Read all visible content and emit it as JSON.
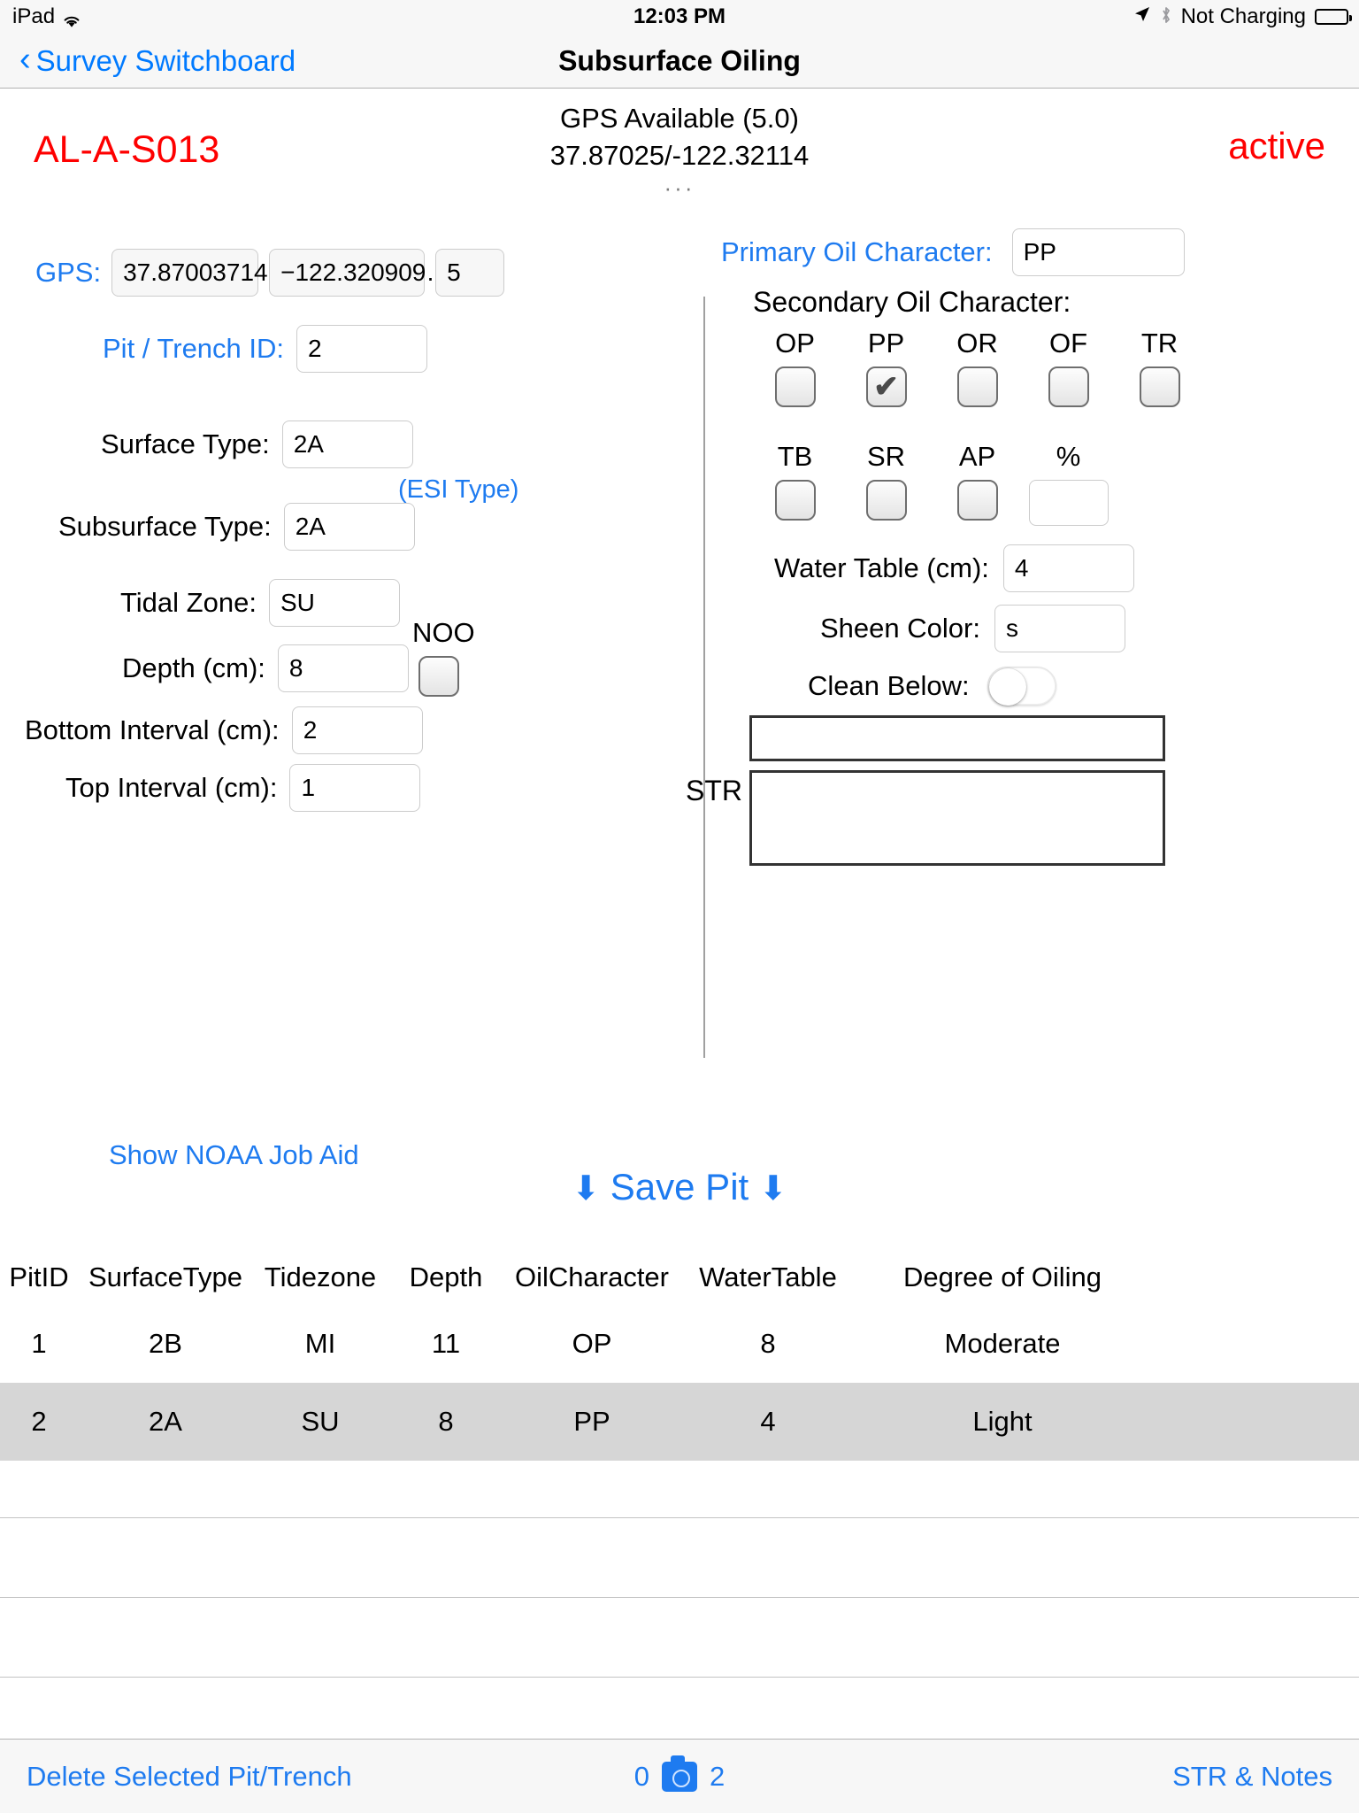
{
  "status_bar": {
    "device": "iPad",
    "wifi_icon": "wifi-icon",
    "time": "12:03 PM",
    "location_icon": "location-arrow-icon",
    "bluetooth_icon": "bluetooth-icon",
    "battery_text": "Not Charging",
    "battery_icon": "battery-icon"
  },
  "navbar": {
    "back_label": "Survey Switchboard",
    "back_icon": "chevron-left-icon",
    "title": "Subsurface Oiling"
  },
  "header": {
    "site_code": "AL-A-S013",
    "gps_status": "GPS Available (5.0)",
    "gps_coords": "37.87025/-122.32114",
    "status": "active",
    "overflow": "···",
    "colors": {
      "alert": "#fe0000",
      "accent": "#1e7bf0"
    }
  },
  "left_form": {
    "gps": {
      "label": "GPS:",
      "lat_value": "37.87003714…",
      "lon_value": "−122.320909…",
      "accuracy_value": "5"
    },
    "pit_trench_id": {
      "label": "Pit / Trench ID:",
      "value": "2"
    },
    "surface_type": {
      "label": "Surface Type:",
      "value": "2A"
    },
    "esi_note": "(ESI Type)",
    "subsurface_type": {
      "label": "Subsurface Type:",
      "value": "2A"
    },
    "tidal_zone": {
      "label": "Tidal Zone:",
      "value": "SU"
    },
    "depth": {
      "label": "Depth (cm):",
      "value": "8"
    },
    "bottom_interval": {
      "label": "Bottom Interval (cm):",
      "value": "2"
    },
    "top_interval": {
      "label": "Top Interval (cm):",
      "value": "1"
    },
    "noo": {
      "label": "NOO",
      "checked": false
    }
  },
  "right_form": {
    "primary_oil_character": {
      "label": "Primary Oil Character:",
      "value": "PP"
    },
    "secondary_oil_character": {
      "label": "Secondary Oil Character:",
      "row1": [
        {
          "label": "OP",
          "checked": false
        },
        {
          "label": "PP",
          "checked": true
        },
        {
          "label": "OR",
          "checked": false
        },
        {
          "label": "OF",
          "checked": false
        },
        {
          "label": "TR",
          "checked": false
        }
      ],
      "row2": [
        {
          "label": "TB",
          "checked": false
        },
        {
          "label": "SR",
          "checked": false
        },
        {
          "label": "AP",
          "checked": false
        }
      ],
      "percent": {
        "label": "%",
        "value": ""
      }
    },
    "water_table": {
      "label": "Water Table (cm):",
      "value": "4"
    },
    "sheen_color": {
      "label": "Sheen Color:",
      "value": "s"
    },
    "clean_below": {
      "label": "Clean Below:",
      "on": false
    },
    "str": {
      "label": "STR",
      "line1": "",
      "line2": ""
    }
  },
  "actions": {
    "job_aid": "Show NOAA Job Aid",
    "save_pit": "Save Pit",
    "save_arrow_left": "⬇",
    "save_arrow_right": "⬇"
  },
  "table": {
    "headers": [
      "PitID",
      "SurfaceType",
      "Tidezone",
      "Depth",
      "OilCharacter",
      "WaterTable",
      "Degree of Oiling"
    ],
    "rows": [
      {
        "cells": [
          "1",
          "2B",
          "MI",
          "11",
          "OP",
          "8",
          "Moderate"
        ],
        "selected": false
      },
      {
        "cells": [
          "2",
          "2A",
          "SU",
          "8",
          "PP",
          "4",
          "Light"
        ],
        "selected": true
      }
    ],
    "empty_rows": 3
  },
  "toolbar": {
    "delete_label": "Delete Selected Pit/Trench",
    "photo_count_left": "0",
    "camera_icon": "camera-icon",
    "photo_count_right": "2",
    "str_notes_label": "STR & Notes"
  }
}
